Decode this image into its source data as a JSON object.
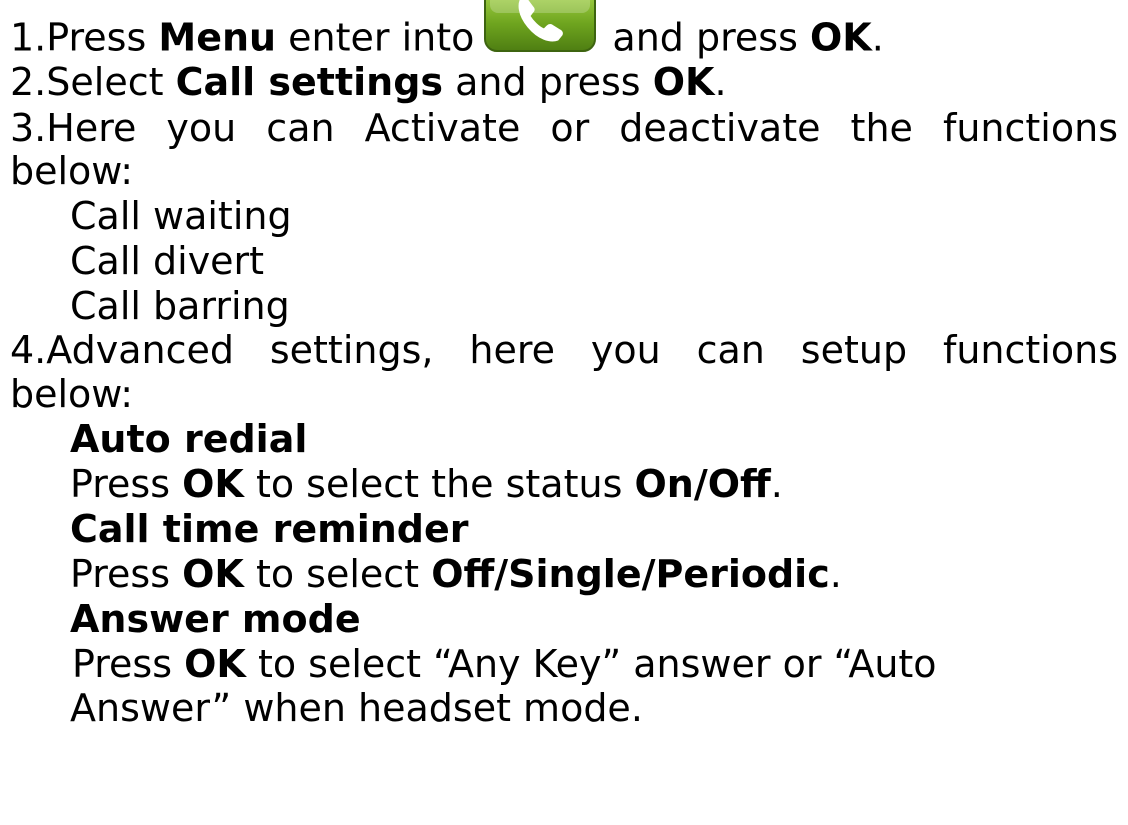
{
  "step1": {
    "number": "1.",
    "press": "Press",
    "menu": "Menu",
    "enter_into": "enter into",
    "and_press": "and press",
    "ok": "OK",
    "end": ".",
    "icon": "phone-icon"
  },
  "step2": {
    "number": "2.",
    "select": "Select",
    "call_settings": "Call settings",
    "and_press": "and press",
    "ok": "OK",
    "end": "."
  },
  "step3": {
    "text_a": "3.Here you can Activate or deactivate the functions",
    "text_b": "below:",
    "items": [
      "Call waiting",
      "Call divert",
      "Call barring"
    ]
  },
  "step4": {
    "text_a": "4.Advanced settings, here you can setup functions",
    "text_b": "below:",
    "auto_redial": {
      "title": "Auto redial",
      "press": "Press",
      "ok": "OK",
      "mid": "to select the status",
      "value": "On/Off",
      "end": "."
    },
    "call_time_reminder": {
      "title": "Call time reminder",
      "press": "Press",
      "ok": "OK",
      "mid": "to select",
      "value": "Off/Single/Periodic",
      "end": "."
    },
    "answer_mode": {
      "title": "Answer mode",
      "press": "Press",
      "ok": "OK",
      "mid": "to select “Any Key” answer or “Auto",
      "line2": "Answer” when headset mode."
    }
  }
}
